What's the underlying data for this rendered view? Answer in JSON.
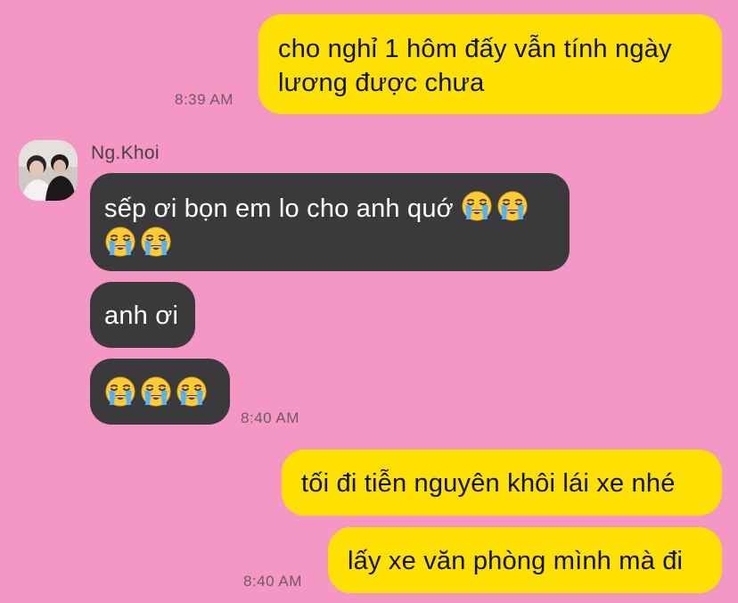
{
  "chat": {
    "messages": [
      {
        "direction": "outgoing",
        "lines": [
          "cho nghỉ 1 hôm đấy vẫn tính ngày",
          "lương được chưa"
        ],
        "time": "8:39 AM"
      },
      {
        "direction": "incoming",
        "sender": "Ng.Khoi",
        "text": "sếp ơi bọn em lo cho anh quớ",
        "emoji_icon": "loudly-crying-face-icon",
        "emoji_count": 4
      },
      {
        "direction": "incoming",
        "text": "anh ơi"
      },
      {
        "direction": "incoming",
        "emoji_icon": "loudly-crying-face-icon",
        "emoji_count": 3,
        "time": "8:40 AM"
      },
      {
        "direction": "outgoing",
        "text": "tối đi tiễn nguyên khôi lái xe nhé"
      },
      {
        "direction": "outgoing",
        "text": "lấy xe văn phòng mình mà đi",
        "time": "8:40 AM"
      }
    ]
  },
  "colors": {
    "background": "#f497c4",
    "outgoing_bubble": "#ffe100",
    "incoming_bubble": "#3a3a3c",
    "timestamp": "#6d5a66"
  }
}
